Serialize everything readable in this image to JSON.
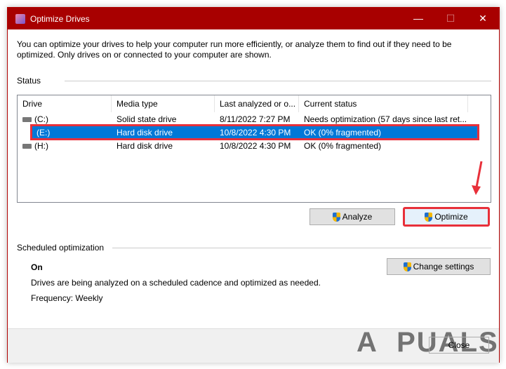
{
  "window": {
    "title": "Optimize Drives",
    "minimize": "—",
    "maximize": "☐",
    "close": "✕"
  },
  "description": "You can optimize your drives to help your computer run more efficiently, or analyze them to find out if they need to be optimized. Only drives on or connected to your computer are shown.",
  "status": {
    "label": "Status",
    "columns": [
      "Drive",
      "Media type",
      "Last analyzed or o...",
      "Current status"
    ],
    "rows": [
      {
        "drive": "(C:)",
        "media": "Solid state drive",
        "last": "8/11/2022 7:27 PM",
        "status": "Needs optimization (57 days since last ret..."
      },
      {
        "drive": "(E:)",
        "media": "Hard disk drive",
        "last": "10/8/2022 4:30 PM",
        "status": "OK (0% fragmented)"
      },
      {
        "drive": "(H:)",
        "media": "Hard disk drive",
        "last": "10/8/2022 4:30 PM",
        "status": "OK (0% fragmented)"
      }
    ],
    "analyze": "Analyze",
    "optimize": "Optimize"
  },
  "scheduled": {
    "label": "Scheduled optimization",
    "state": "On",
    "text": "Drives are being analyzed on a scheduled cadence and optimized as needed.",
    "frequency": "Frequency: Weekly",
    "change": "Change settings"
  },
  "close_button": "Close",
  "watermark": "APPUALS"
}
